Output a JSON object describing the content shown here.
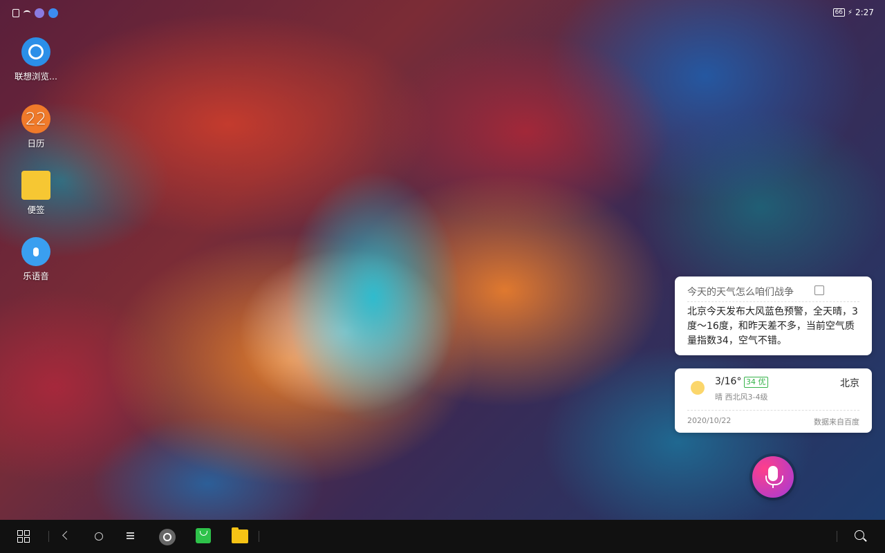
{
  "status_bar": {
    "battery": "66",
    "time": "2:27"
  },
  "desktop_icons": [
    {
      "label": "联想浏览...",
      "icon": "browser-icon"
    },
    {
      "label": "日历",
      "icon": "calendar-icon",
      "badge": "22"
    },
    {
      "label": "便签",
      "icon": "notes-icon"
    },
    {
      "label": "乐语音",
      "icon": "microphone-icon"
    }
  ],
  "assistant": {
    "query": "今天的天气怎么咱们战争",
    "answer": "北京今天发布大风蓝色预警，全天晴，3度～16度，和昨天差不多，当前空气质量指数34，空气不错。"
  },
  "weather": {
    "temp": "3/16°",
    "aqi": "34 优",
    "city": "北京",
    "desc": "晴  西北风3-4级",
    "date": "2020/10/22",
    "source": "数据来自百度"
  },
  "colors": {
    "accent_green": "#36b34a",
    "mic_gradient_start": "#ff3f8a",
    "mic_gradient_end": "#a23ad8"
  }
}
